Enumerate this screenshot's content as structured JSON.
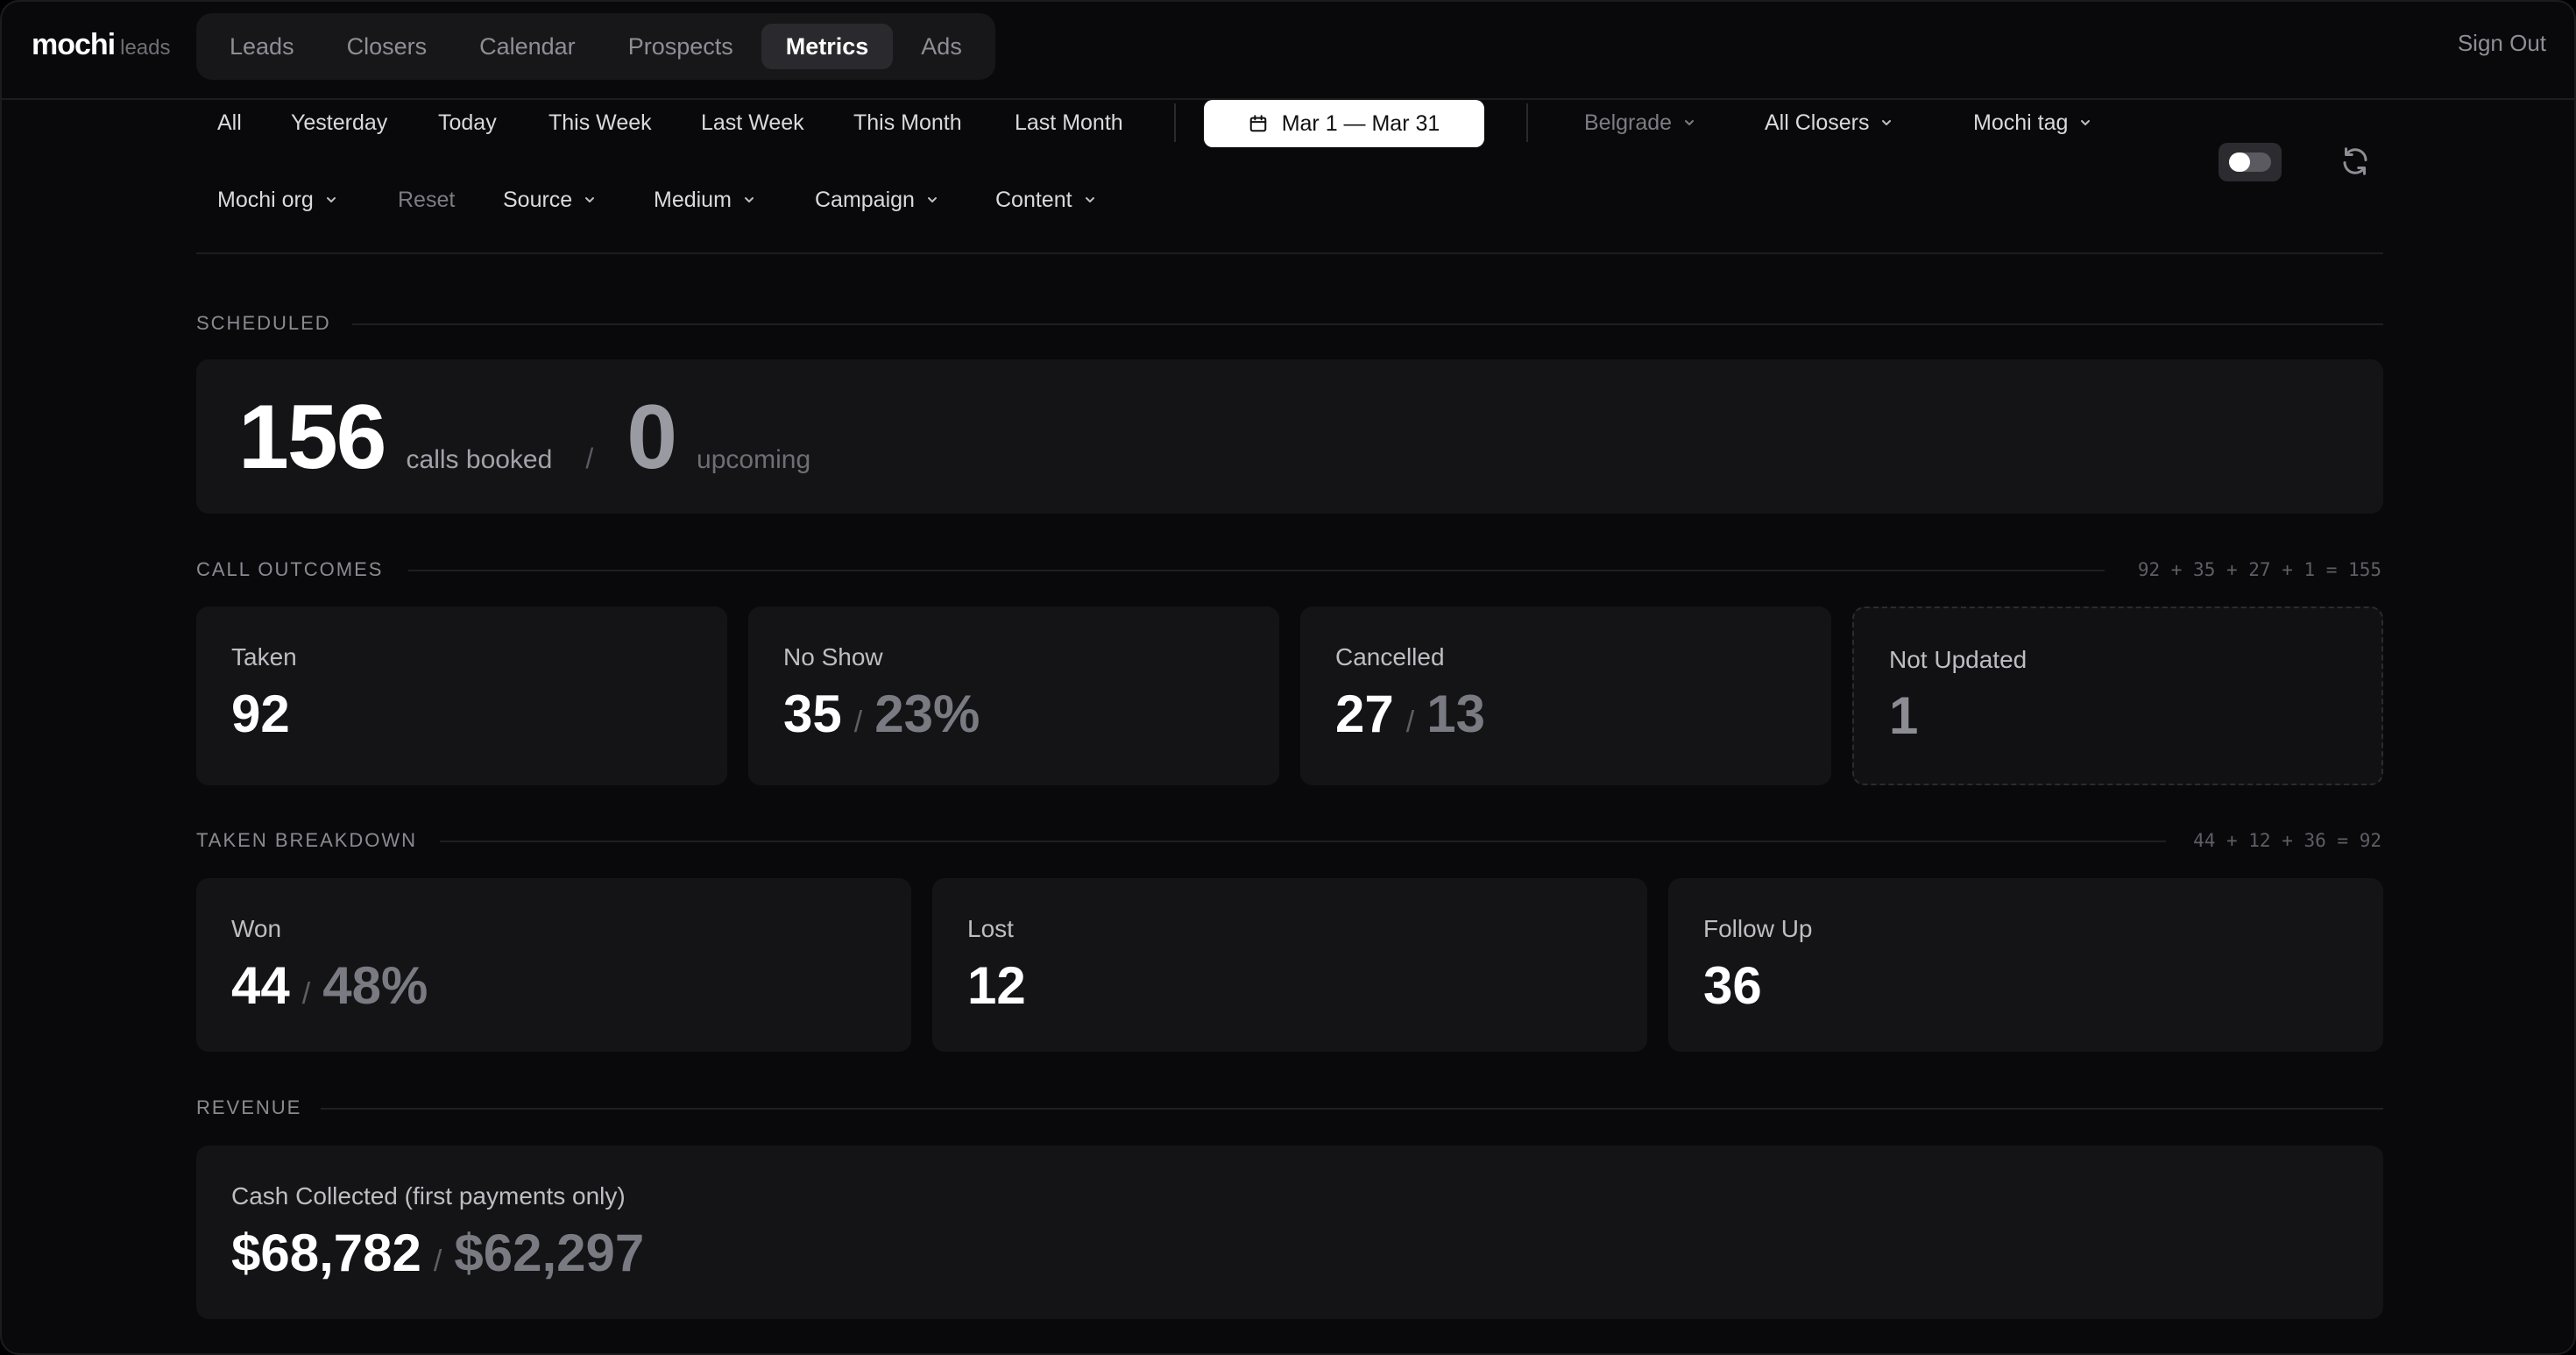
{
  "brand": {
    "name": "mochi",
    "sub": "leads"
  },
  "nav": {
    "tabs": [
      {
        "label": "Leads",
        "active": false
      },
      {
        "label": "Closers",
        "active": false
      },
      {
        "label": "Calendar",
        "active": false
      },
      {
        "label": "Prospects",
        "active": false
      },
      {
        "label": "Metrics",
        "active": true
      },
      {
        "label": "Ads",
        "active": false
      }
    ],
    "sign_out": "Sign Out"
  },
  "filters": {
    "ranges": [
      "All",
      "Yesterday",
      "Today",
      "This Week",
      "Last Week",
      "This Month",
      "Last Month"
    ],
    "date_range": "Mar 1 — Mar 31",
    "location": "Belgrade",
    "closers": "All Closers",
    "tag": "Mochi tag",
    "org": "Mochi org",
    "reset": "Reset",
    "source": "Source",
    "medium": "Medium",
    "campaign": "Campaign",
    "content": "Content"
  },
  "scheduled": {
    "label": "SCHEDULED",
    "booked": "156",
    "booked_unit": "calls booked",
    "slash": "/",
    "upcoming": "0",
    "upcoming_unit": "upcoming"
  },
  "outcomes": {
    "label": "CALL OUTCOMES",
    "formula": "92 + 35 + 27 + 1 = 155",
    "taken": {
      "label": "Taken",
      "value": "92"
    },
    "no_show": {
      "label": "No Show",
      "value": "35",
      "sub": "23%"
    },
    "cancelled": {
      "label": "Cancelled",
      "value": "27",
      "sub": "13"
    },
    "not_updated": {
      "label": "Not Updated",
      "value": "1"
    }
  },
  "breakdown": {
    "label": "TAKEN BREAKDOWN",
    "formula": "44 + 12 + 36 = 92",
    "won": {
      "label": "Won",
      "value": "44",
      "sub": "48%"
    },
    "lost": {
      "label": "Lost",
      "value": "12"
    },
    "follow_up": {
      "label": "Follow Up",
      "value": "36"
    }
  },
  "revenue": {
    "label": "REVENUE",
    "cash": {
      "label": "Cash Collected (first payments only)",
      "value": "$68,782",
      "sub": "$62,297"
    }
  },
  "separator": "/",
  "icons": {
    "calendar": "calendar-icon",
    "chevron": "chevron-down-icon",
    "refresh": "refresh-icon",
    "toggle": "toggle-switch"
  }
}
